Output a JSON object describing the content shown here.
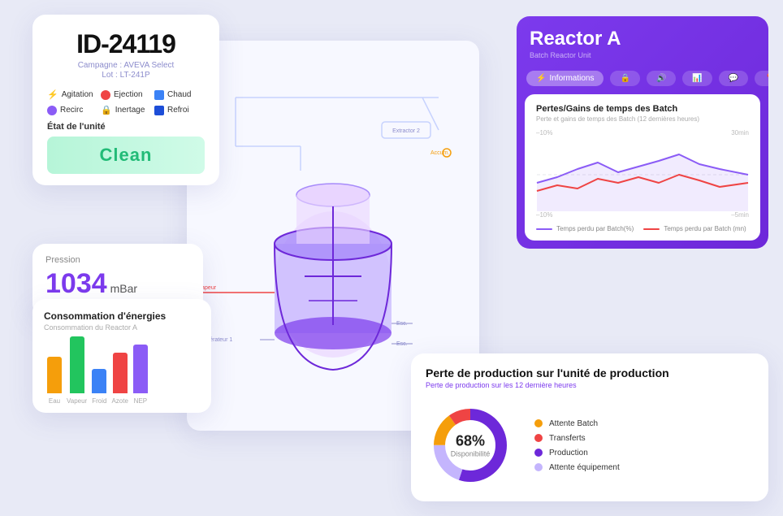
{
  "id_card": {
    "id": "ID-24119",
    "campaign": "Campagne : AVEVA Select",
    "lot": "Lot : LT-241P",
    "badges": [
      {
        "label": "Agitation",
        "color": "#f59e0b",
        "icon": "⚡"
      },
      {
        "label": "Ejection",
        "color": "#ef4444",
        "icon": "●"
      },
      {
        "label": "Chaud",
        "color": "#3b82f6",
        "icon": "■"
      },
      {
        "label": "Recirc",
        "color": "#8b5cf6",
        "icon": "●"
      },
      {
        "label": "Inertage",
        "color": "#f97316",
        "icon": "🔒"
      },
      {
        "label": "Refroi",
        "color": "#1d4ed8",
        "icon": "■"
      }
    ],
    "etat_label": "État de l'unité",
    "status": "Clean",
    "status_color": "#22bb77"
  },
  "pression_card": {
    "label": "Pression",
    "value": "1034",
    "unit": "mBar"
  },
  "conso_card": {
    "title": "Consommation d'énergies",
    "subtitle": "Consommation du Reactor A",
    "bars": [
      {
        "label": "Eau",
        "color": "#f59e0b",
        "height": 45
      },
      {
        "label": "Vapeur",
        "color": "#22c55e",
        "height": 70
      },
      {
        "label": "Froid",
        "color": "#3b82f6",
        "height": 30
      },
      {
        "label": "Azote",
        "color": "#ef4444",
        "height": 50
      },
      {
        "label": "NEP",
        "color": "#8b5cf6",
        "height": 60
      }
    ]
  },
  "reactor_card": {
    "title": "Reactor A",
    "subtitle": "Batch Reactor Unit",
    "tabs": [
      {
        "label": "Informations",
        "active": true,
        "icon": "⚡"
      },
      {
        "label": "",
        "icon": "🔒"
      },
      {
        "label": "",
        "icon": "🔊"
      },
      {
        "label": "",
        "icon": "📊"
      },
      {
        "label": "",
        "icon": "💬"
      },
      {
        "label": "",
        "icon": "📍"
      }
    ],
    "chart": {
      "title": "Pertes/Gains de temps des Batch",
      "subtitle": "Perte et gains de temps des Batch (12 dernières heures)",
      "y_left_top": "–10%",
      "y_left_bottom": "–10%",
      "y_right_top": "30min",
      "y_right_bottom": "–5min",
      "legend": [
        {
          "label": "Temps perdu par Batch(%)",
          "color": "#8b5cf6"
        },
        {
          "label": "Temps perdu par Batch (mn)",
          "color": "#ef4444"
        }
      ]
    }
  },
  "perte_card": {
    "title": "Perte de production sur l'unité de production",
    "subtitle": "Perte de production sur les 12 dernière heures",
    "donut": {
      "percentage": "68%",
      "label": "Disponibilité",
      "segments": [
        {
          "label": "Attente Batch",
          "color": "#f59e0b",
          "value": 15
        },
        {
          "label": "Transferts",
          "color": "#ef4444",
          "value": 10
        },
        {
          "label": "Production",
          "color": "#6d28d9",
          "value": 55
        },
        {
          "label": "Attente équipement",
          "color": "#c4b5fd",
          "value": 20
        }
      ]
    }
  }
}
